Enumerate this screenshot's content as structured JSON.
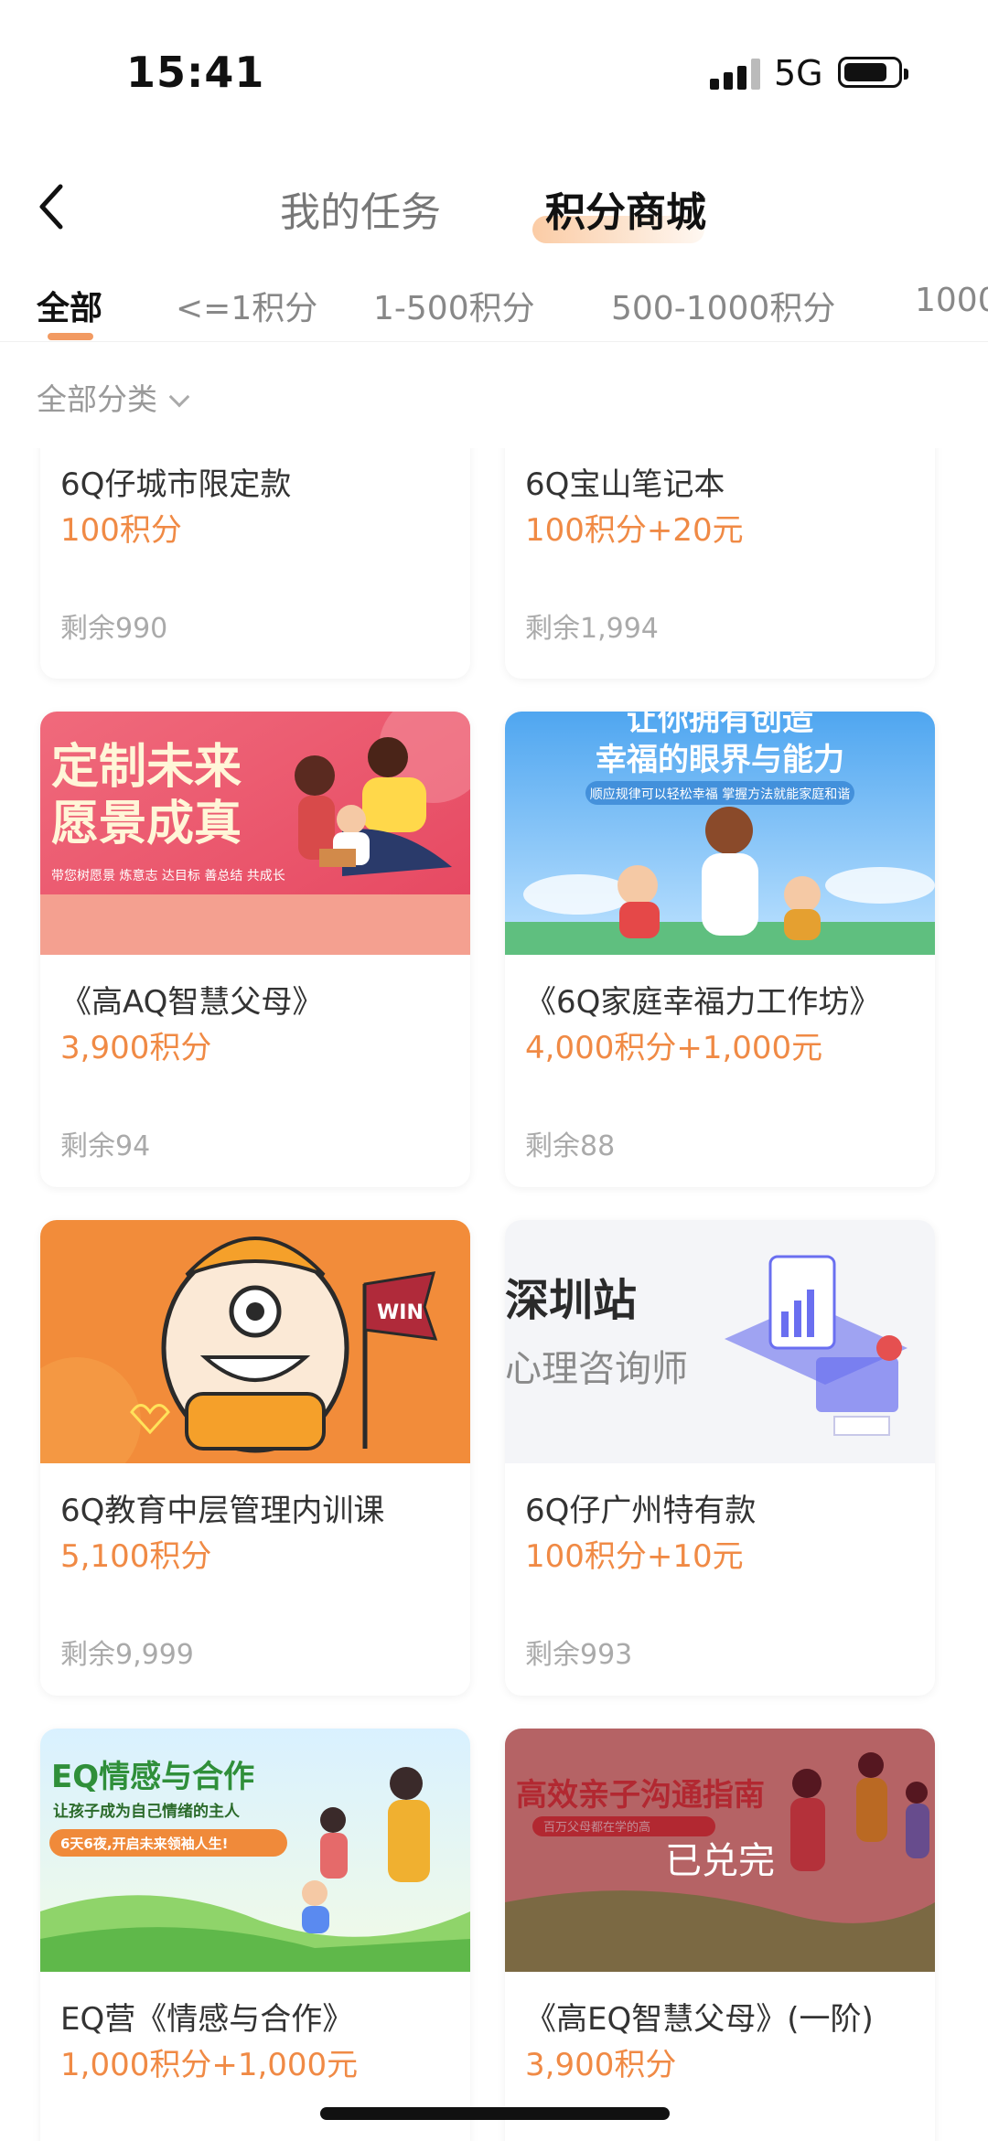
{
  "status_bar": {
    "time": "15:41",
    "network": "5G"
  },
  "header": {
    "tabs": [
      "我的任务",
      "积分商城"
    ],
    "active_tab": "积分商城"
  },
  "filters": [
    "全部",
    "<=1积分",
    "1-500积分",
    "500-1000积分",
    "1000"
  ],
  "category": {
    "label": "全部分类"
  },
  "products": [
    {
      "title": "6Q仔城市限定款",
      "price": "100积分",
      "remain": "剩余990"
    },
    {
      "title": "6Q宝山笔记本",
      "price": "100积分+20元",
      "remain": "剩余1,994"
    },
    {
      "title": "《高AQ智慧父母》",
      "price": "3,900积分",
      "remain": "剩余94",
      "image_text": [
        "定制未来",
        "愿景成真",
        "带您树愿景 炼意志 达目标 善总结 共成长"
      ]
    },
    {
      "title": "《6Q家庭幸福力工作坊》",
      "price": "4,000积分+1,000元",
      "remain": "剩余88",
      "image_text": [
        "让你拥有创造",
        "幸福的眼界与能力",
        "顺应规律可以轻松幸福 掌握方法就能家庭和谐"
      ]
    },
    {
      "title": "6Q教育中层管理内训课",
      "price": "5,100积分",
      "remain": "剩余9,999",
      "image_text": [
        "WIN"
      ]
    },
    {
      "title": "6Q仔广州特有款",
      "price": "100积分+10元",
      "remain": "剩余993",
      "image_text": [
        "深圳站",
        "心理咨询师"
      ]
    },
    {
      "title": "EQ营《情感与合作》",
      "price": "1,000积分+1,000元",
      "remain": "",
      "image_text": [
        "EQ情感与合作",
        "让孩子成为自己情绪的主人",
        "6天6夜,开启未来领袖人生!"
      ]
    },
    {
      "title": "《高EQ智慧父母》(一阶)",
      "price": "3,900积分",
      "remain": "",
      "image_text": [
        "高效亲子沟通指南",
        "百万父母都在学的高"
      ],
      "badge": "已兑完"
    }
  ]
}
